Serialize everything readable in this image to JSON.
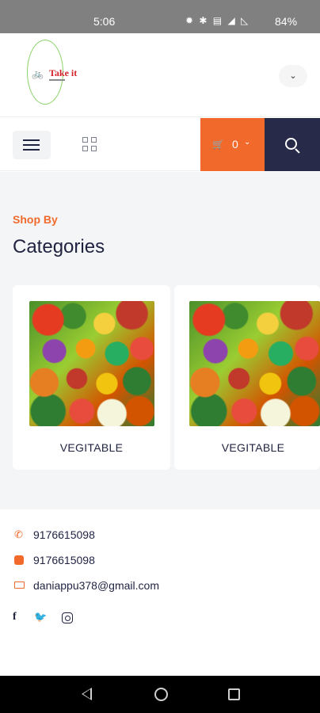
{
  "status_bar": {
    "time": "5:06",
    "icons": "✹ ✱ ▤ ◢ ◺",
    "battery": "84%"
  },
  "header": {
    "logo_text": "Take it",
    "language_chevron": "⌄"
  },
  "navbar": {
    "cart_count": "0",
    "cart_chevron": "⌄"
  },
  "categories": {
    "kicker": "Shop By",
    "title": "Categories",
    "items": [
      {
        "label": "VEGITABLE"
      },
      {
        "label": "VEGITABLE"
      }
    ]
  },
  "footer": {
    "phone": "9176615098",
    "whatsapp": "9176615098",
    "email": "daniappu378@gmail.com",
    "social": {
      "facebook": "f",
      "twitter": "🐦"
    }
  },
  "colors": {
    "accent": "#f26a2b",
    "navy": "#282a4a",
    "text": "#1f2340",
    "section_bg": "#f4f5f7"
  }
}
